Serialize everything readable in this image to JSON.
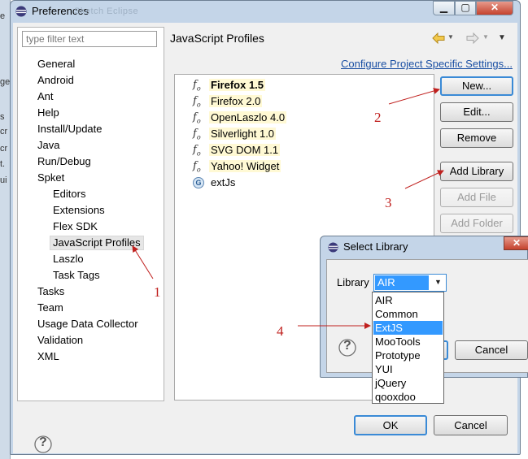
{
  "window": {
    "title": "Preferences",
    "ghost_title": "Sketch   Eclipse"
  },
  "filter": {
    "placeholder": "type filter text"
  },
  "tree": [
    {
      "label": "General"
    },
    {
      "label": "Android"
    },
    {
      "label": "Ant"
    },
    {
      "label": "Help"
    },
    {
      "label": "Install/Update"
    },
    {
      "label": "Java"
    },
    {
      "label": "Run/Debug"
    },
    {
      "label": "Spket"
    },
    {
      "label": "Editors"
    },
    {
      "label": "Extensions"
    },
    {
      "label": "Flex SDK"
    },
    {
      "label": "JavaScript Profiles"
    },
    {
      "label": "Laszlo"
    },
    {
      "label": "Task Tags"
    },
    {
      "label": "Tasks"
    },
    {
      "label": "Team"
    },
    {
      "label": "Usage Data Collector"
    },
    {
      "label": "Validation"
    },
    {
      "label": "XML"
    }
  ],
  "page": {
    "title": "JavaScript Profiles",
    "configure_link": "Configure Project Specific Settings..."
  },
  "profiles": [
    {
      "label": "Firefox 1.5",
      "icon": "fo"
    },
    {
      "label": "Firefox 2.0",
      "icon": "fo"
    },
    {
      "label": "OpenLaszlo 4.0",
      "icon": "fo"
    },
    {
      "label": "Silverlight 1.0",
      "icon": "fo"
    },
    {
      "label": "SVG DOM 1.1",
      "icon": "fo"
    },
    {
      "label": "Yahoo! Widget",
      "icon": "fo"
    },
    {
      "label": "extJs",
      "icon": "G"
    }
  ],
  "buttons": {
    "new": "New...",
    "edit": "Edit...",
    "remove": "Remove",
    "add_library": "Add Library",
    "add_file": "Add File",
    "add_folder": "Add Folder",
    "ok": "OK",
    "cancel": "Cancel",
    "help": "?"
  },
  "dialog": {
    "title": "Select Library",
    "library_label": "Library",
    "selected": "AIR",
    "cancel": "Cancel",
    "options": [
      "AIR",
      "Common",
      "ExtJS",
      "MooTools",
      "Prototype",
      "YUI",
      "jQuery",
      "qooxdoo"
    ],
    "highlighted_index": 2
  },
  "annotations": [
    "1",
    "2",
    "3",
    "4"
  ],
  "colors": {
    "accent": "#3399ff",
    "annotation": "#c0201e",
    "link": "#1a4fa3"
  }
}
